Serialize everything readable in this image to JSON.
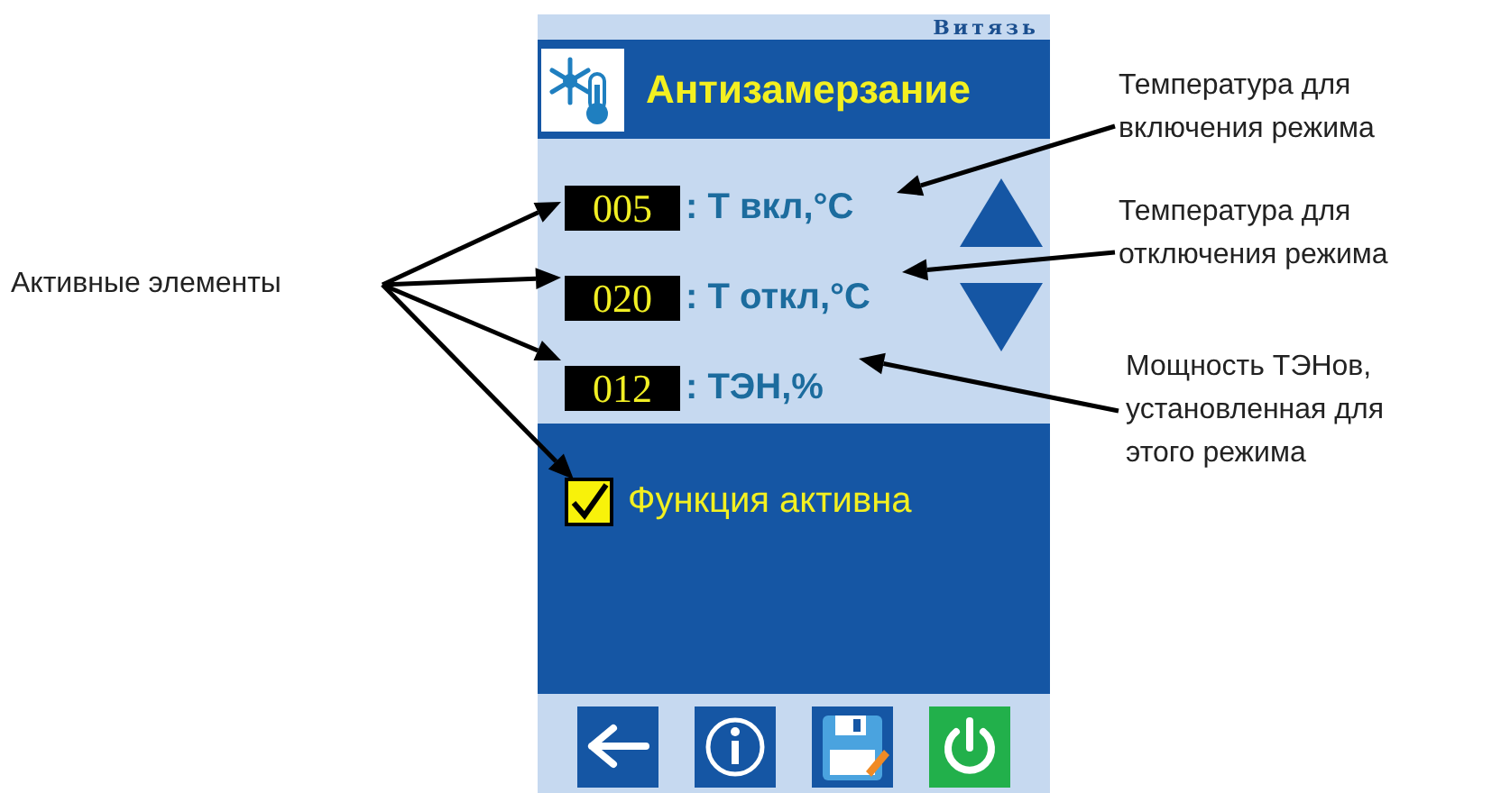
{
  "brand": "Витязь",
  "title": "Антизамерзание",
  "params": [
    {
      "value": "005",
      "label": ": Т вкл,°C"
    },
    {
      "value": "020",
      "label": ": Т откл,°C"
    },
    {
      "value": "012",
      "label": ": ТЭН,%"
    }
  ],
  "steppers": [
    {
      "kind": "up"
    },
    {
      "kind": "down"
    }
  ],
  "checkbox": {
    "label": "Функция активна",
    "checked": true
  },
  "toolbar": [
    {
      "kind": "back"
    },
    {
      "kind": "info"
    },
    {
      "kind": "save"
    },
    {
      "kind": "power"
    }
  ],
  "left_callout": {
    "text": "Активные элементы"
  },
  "right_callouts": [
    {
      "text": "Температура для включения режима"
    },
    {
      "text": "Температура для отключения режима"
    },
    {
      "text": "Мощность ТЭНов, установленная для этого режима"
    }
  ]
}
